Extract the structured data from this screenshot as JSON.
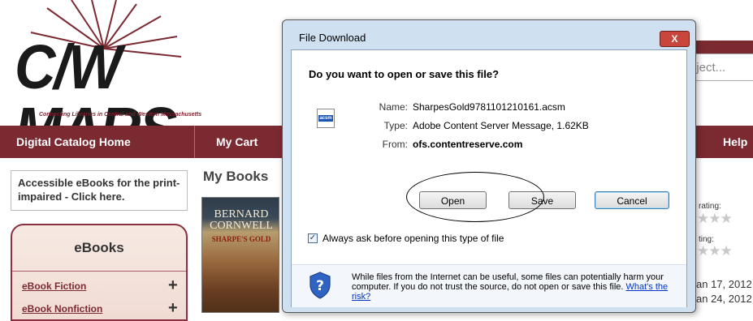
{
  "logo": {
    "wordmark": "C/W MARS",
    "tagline": "Connecting Libraries in Central and Western Massachusetts"
  },
  "nav": {
    "items": [
      "Digital Catalog Home",
      "My Cart",
      "Help"
    ]
  },
  "search": {
    "placeholder_partial": "oject..."
  },
  "accessible": {
    "text": "Accessible eBooks for the print-impaired - Click here."
  },
  "sidebar": {
    "panel_title": "eBooks",
    "links": [
      "eBook Fiction",
      "eBook Nonfiction"
    ]
  },
  "main": {
    "title": "My Books",
    "book": {
      "author_line1": "BERNARD",
      "author_line2": "CORNWELL",
      "series": "SHARPE'S GOLD"
    },
    "ratings": [
      "rating:",
      "ting:"
    ],
    "dates": [
      "an 17, 2012",
      "an 24, 2012"
    ]
  },
  "dialog": {
    "title": "File Download",
    "close_label": "X",
    "question": "Do you want to open or save this file?",
    "name_label": "Name:",
    "name_value": "SharpesGold9781101210161.acsm",
    "type_label": "Type:",
    "type_value": "Adobe Content Server Message, 1.62KB",
    "from_label": "From:",
    "from_value": "ofs.contentreserve.com",
    "buttons": {
      "open": "Open",
      "save": "Save",
      "cancel": "Cancel"
    },
    "checkbox_label": "Always ask before opening this type of file",
    "checkbox_checked": true,
    "warning": "While files from the Internet can be useful, some files can potentially harm your computer. If you do not trust the source, do not open or save this file.",
    "warning_link": "What's the risk?",
    "file_icon_text": "acsm"
  },
  "colors": {
    "brand_maroon": "#7b2a32",
    "dialog_frame": "#cfe0f1",
    "close_red": "#c8463c",
    "link_blue": "#0033cc"
  }
}
